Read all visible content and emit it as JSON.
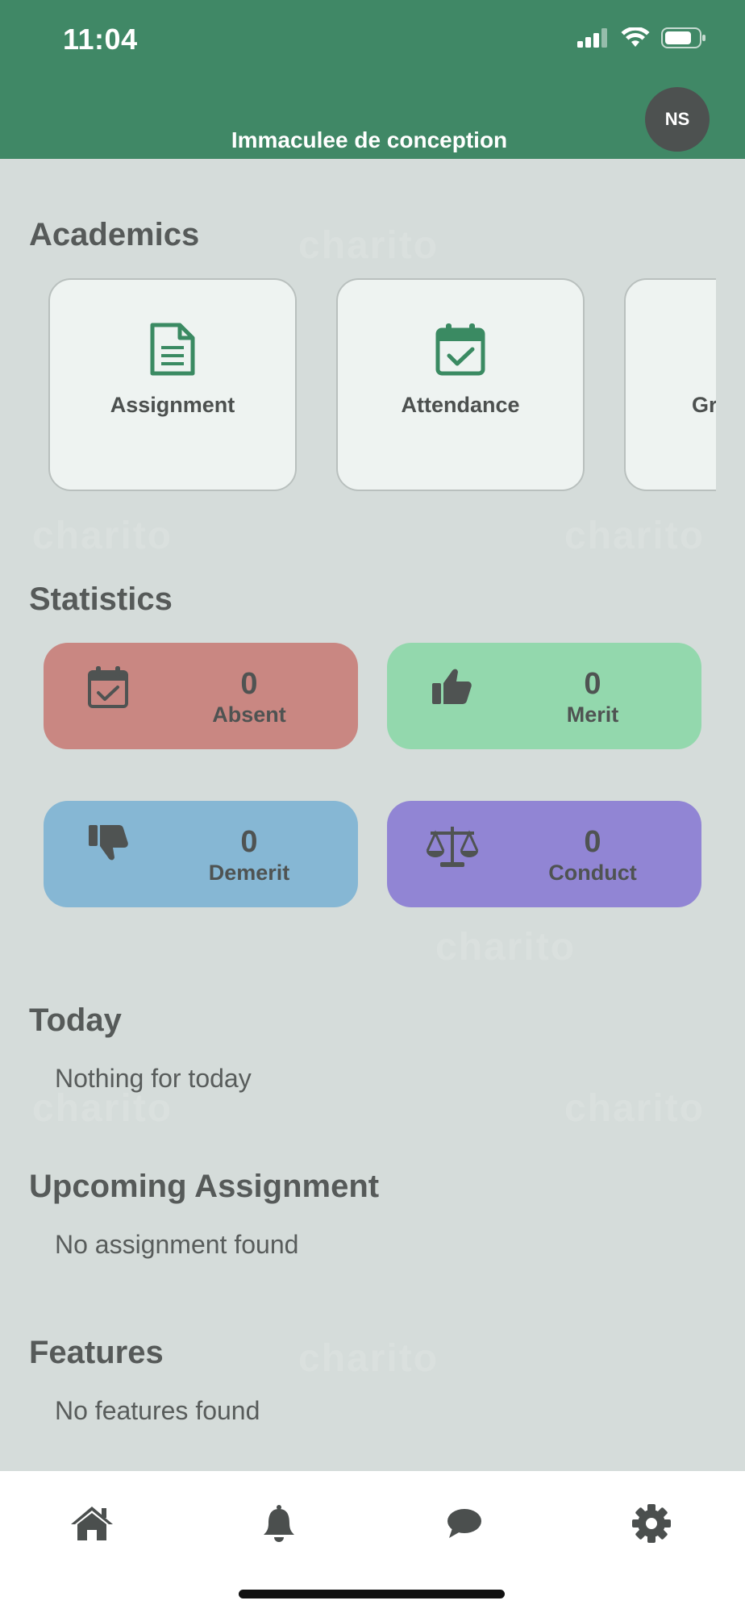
{
  "status_bar": {
    "time": "11:04"
  },
  "header": {
    "school_name": "Immaculee de conception",
    "avatar_initials": "NS"
  },
  "watermark_text": "charito",
  "academics": {
    "title": "Academics",
    "tiles": [
      {
        "label": "Assignment",
        "icon": "document-icon"
      },
      {
        "label": "Attendance",
        "icon": "calendar-check-icon"
      },
      {
        "label": "Gr",
        "icon": "grades-icon"
      }
    ]
  },
  "statistics": {
    "title": "Statistics",
    "items": [
      {
        "label": "Absent",
        "value": "0",
        "color": "#c98782",
        "icon": "calendar-check-icon"
      },
      {
        "label": "Merit",
        "value": "0",
        "color": "#93d8ad",
        "icon": "thumbs-up-icon"
      },
      {
        "label": "Demerit",
        "value": "0",
        "color": "#86b7d4",
        "icon": "thumbs-down-icon"
      },
      {
        "label": "Conduct",
        "value": "0",
        "color": "#9185d4",
        "icon": "scale-icon"
      }
    ]
  },
  "today": {
    "title": "Today",
    "empty_text": "Nothing for today"
  },
  "upcoming": {
    "title": "Upcoming Assignment",
    "empty_text": "No assignment found"
  },
  "features": {
    "title": "Features",
    "empty_text": "No features found"
  },
  "tabbar": {
    "items": [
      {
        "icon": "home-icon"
      },
      {
        "icon": "bell-icon"
      },
      {
        "icon": "chat-icon"
      },
      {
        "icon": "gear-icon"
      }
    ]
  },
  "colors": {
    "brand_green": "#408866",
    "icon_green": "#3a8a62"
  }
}
